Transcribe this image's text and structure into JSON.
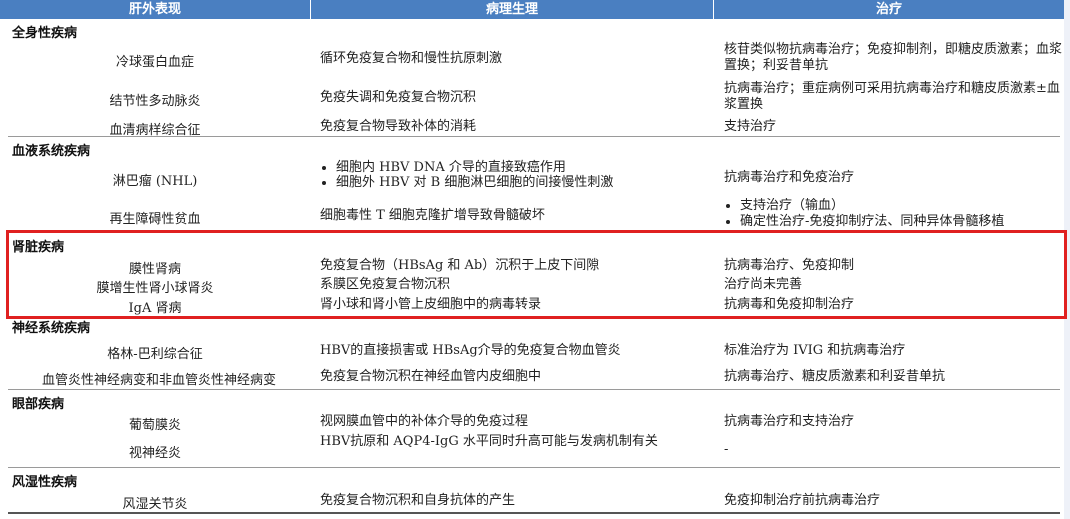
{
  "header": {
    "col1": "肝外表现",
    "col2": "病理生理",
    "col3": "治疗"
  },
  "sections": {
    "systemic": "全身性疾病",
    "blood": "血液系统疾病",
    "kidney": "肾脏疾病",
    "neuro": "神经系统疾病",
    "eye": "眼部疾病",
    "rheum": "风湿性疾病"
  },
  "rows": {
    "cryo": {
      "name": "冷球蛋白血症",
      "path": "循环免疫复合物和慢性抗原刺激",
      "treat": "核苷类似物抗病毒治疗；免疫抑制剂，即糖皮质激素；血浆置换；利妥昔单抗"
    },
    "pan": {
      "name": "结节性多动脉炎",
      "path": "免疫失调和免疫复合物沉积",
      "treat": "抗病毒治疗；重症病例可采用抗病毒治疗和糖皮质激素±血浆置换"
    },
    "serum": {
      "name": "血清病样综合征",
      "path": "免疫复合物导致补体的消耗",
      "treat": "支持治疗"
    },
    "nhl": {
      "name": "淋巴瘤 (NHL)",
      "path_items": [
        "细胞内 HBV DNA 介导的直接致癌作用",
        "细胞外 HBV 对 B 细胞淋巴细胞的间接慢性刺激"
      ],
      "treat": "抗病毒治疗和免疫治疗"
    },
    "aplastic": {
      "name": "再生障碍性贫血",
      "path": "细胞毒性 T 细胞克隆扩增导致骨髓破坏",
      "treat_items": [
        "支持治疗（输血）",
        "确定性治疗-免疫抑制疗法、同种异体骨髓移植"
      ]
    },
    "membranous": {
      "name": "膜性肾病",
      "path": "免疫复合物（HBsAg 和 Ab）沉积于上皮下间隙",
      "treat": "抗病毒治疗、免疫抑制"
    },
    "mpgn": {
      "name": "膜增生性肾小球肾炎",
      "path": "系膜区免疫复合物沉积",
      "treat": "治疗尚未完善"
    },
    "iga": {
      "name": "IgA 肾病",
      "path": "肾小球和肾小管上皮细胞中的病毒转录",
      "treat": "抗病毒和免疫抑制治疗"
    },
    "gbs": {
      "name": "格林-巴利综合征",
      "path": "HBV的直接损害或 HBsAg介导的免疫复合物血管炎",
      "treat": "标准治疗为 IVIG 和抗病毒治疗"
    },
    "vasc": {
      "name": "血管炎性神经病变和非血管炎性神经病变",
      "path": "免疫复合物沉积在神经血管内皮细胞中",
      "treat": "抗病毒治疗、糖皮质激素和利妥昔单抗"
    },
    "uveitis": {
      "name": "葡萄膜炎",
      "path": "视网膜血管中的补体介导的免疫过程",
      "treat": "抗病毒治疗和支持治疗"
    },
    "optic": {
      "name": "视神经炎",
      "path": "HBV抗原和 AQP4-IgG 水平同时升高可能与发病机制有关",
      "treat": "-"
    },
    "arthritis": {
      "name": "风湿关节炎",
      "path": "免疫复合物沉积和自身抗体的产生",
      "treat": "免疫抑制治疗前抗病毒治疗"
    }
  },
  "colors": {
    "header_bg": "#4a7fc1",
    "highlight_border": "#e02020"
  }
}
